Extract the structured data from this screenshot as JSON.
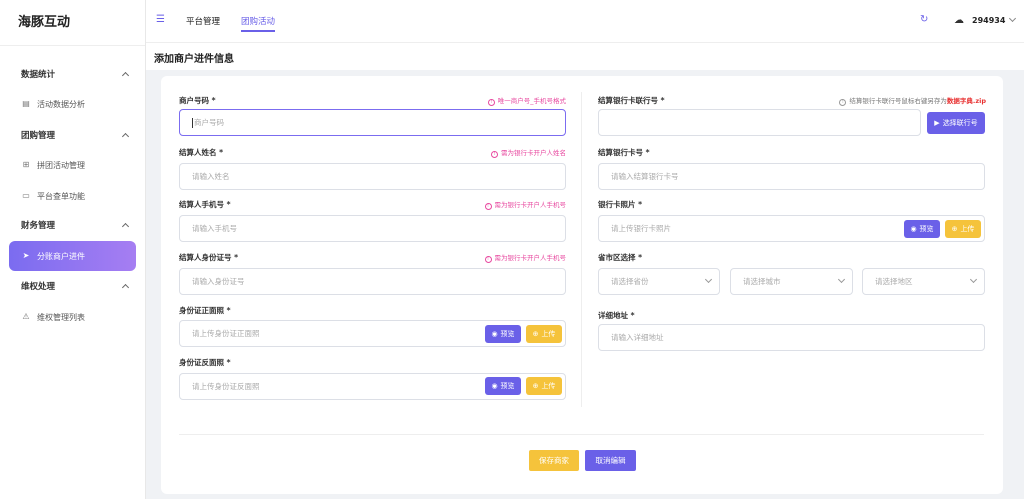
{
  "sidebar": {
    "brand": "海豚互动",
    "groups": [
      {
        "label": "数据统计",
        "items": [
          {
            "label": "活动数据分析",
            "icon": "document-icon"
          }
        ]
      },
      {
        "label": "团购管理",
        "items": [
          {
            "label": "拼团活动管理",
            "icon": "grid-icon"
          },
          {
            "label": "平台查单功能",
            "icon": "folder-icon"
          }
        ]
      },
      {
        "label": "财务管理",
        "items": [
          {
            "label": "分账商户进件",
            "icon": "send-icon"
          }
        ]
      },
      {
        "label": "维权处理",
        "items": [
          {
            "label": "维权管理列表",
            "icon": "warning-icon"
          }
        ]
      }
    ]
  },
  "topbar": {
    "nav": [
      "平台管理",
      "团购活动"
    ],
    "active_nav": "团购活动",
    "user": "294934"
  },
  "page": {
    "title": "添加商户进件信息"
  },
  "form": {
    "merchant_no": {
      "label": "商户号码 *",
      "placeholder": "商户号码",
      "hint": "唯一商户号_手机号格式"
    },
    "account_name": {
      "label": "结算人姓名 *",
      "placeholder": "请输入姓名",
      "hint": "需为银行卡开户人姓名"
    },
    "account_phone": {
      "label": "结算人手机号 *",
      "placeholder": "请输入手机号",
      "hint": "需为银行卡开户人手机号"
    },
    "account_id_no": {
      "label": "结算人身份证号 *",
      "placeholder": "请输入身份证号",
      "hint": "需为银行卡开户人手机号"
    },
    "id_front": {
      "label": "身份证正面照 *",
      "placeholder": "请上传身份证正面照"
    },
    "id_back": {
      "label": "身份证反面照 *",
      "placeholder": "请上传身份证反面照"
    },
    "bank_branch_no": {
      "label": "结算银行卡联行号 *",
      "hint_prefix": "结算银行卡联行号鼠标右键另存为",
      "hint_link": "数据字典.zip",
      "button": "选择联行号"
    },
    "bank_card_no": {
      "label": "结算银行卡号 *",
      "placeholder": "请输入结算银行卡号"
    },
    "bank_card_photo": {
      "label": "银行卡照片 *",
      "placeholder": "请上传银行卡照片"
    },
    "region": {
      "label": "省市区选择 *",
      "province": "请选择省份",
      "city": "请选择城市",
      "district": "请选择地区"
    },
    "address": {
      "label": "详细地址 *",
      "placeholder": "请输入详细地址"
    },
    "preview_label": "预览",
    "upload_label": "上传"
  },
  "actions": {
    "save": "保存商家",
    "cancel": "取消编辑"
  }
}
